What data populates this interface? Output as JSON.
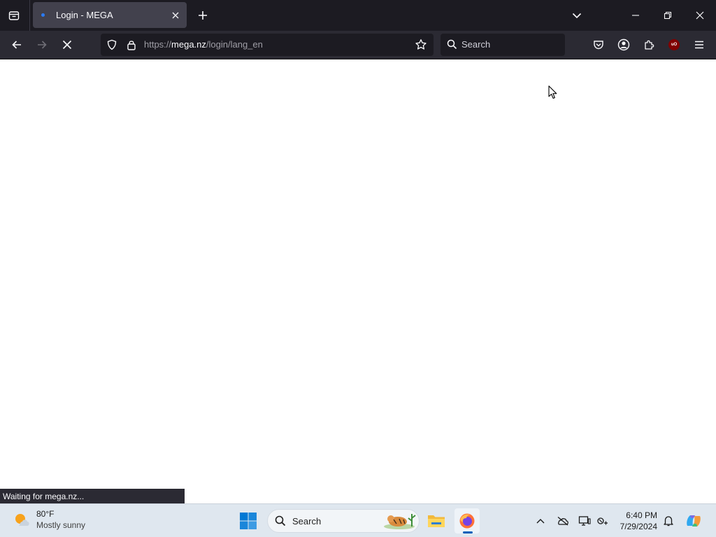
{
  "browser": {
    "tab": {
      "title": "Login - MEGA"
    },
    "url": {
      "scheme": "https://",
      "host": "mega.nz",
      "path": "/login/lang_en"
    },
    "search": {
      "placeholder": "Search"
    },
    "status_text": "Waiting for mega.nz..."
  },
  "taskbar": {
    "weather": {
      "temp": "80°F",
      "condition": "Mostly sunny"
    },
    "search": {
      "placeholder": "Search"
    },
    "clock": {
      "time": "6:40 PM",
      "date": "7/29/2024"
    },
    "apps": [
      "file-explorer",
      "firefox"
    ],
    "active_app": "firefox"
  },
  "colors": {
    "tabstrip_bg": "#1c1b22",
    "toolbar_bg": "#2b2a33",
    "urlbar_bg": "#1c1b22",
    "taskbar_bg": "#dfe7ef",
    "accent": "#005fb8"
  }
}
